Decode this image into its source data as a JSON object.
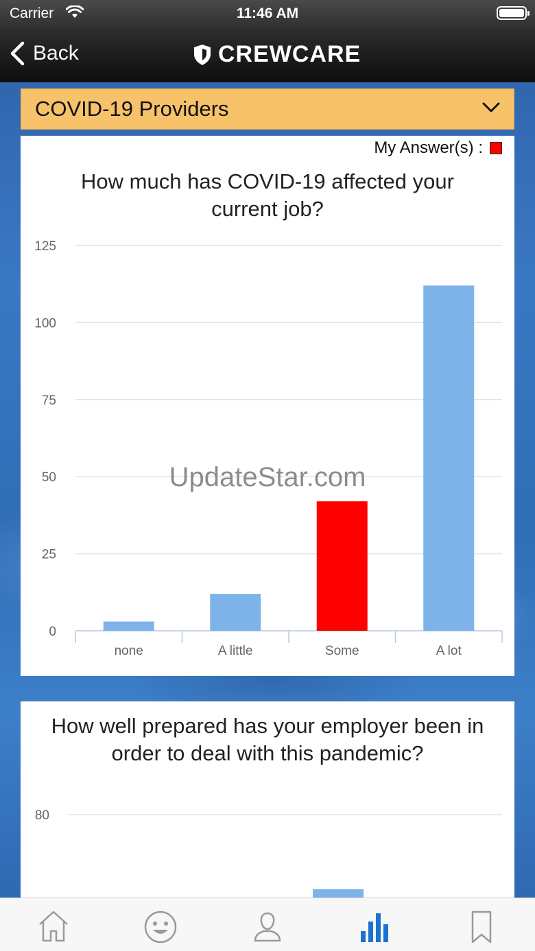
{
  "status_bar": {
    "carrier": "Carrier",
    "time": "11:46 AM"
  },
  "nav": {
    "back_label": "Back",
    "brand": "CREWCARE"
  },
  "dropdown": {
    "selected": "COVID-19 Providers"
  },
  "legend": {
    "my_answers_label": "My Answer(s) :",
    "my_answer_color": "#ff0000"
  },
  "watermark": "UpdateStar.com",
  "colors": {
    "bar": "#7eb3ea",
    "highlight": "#ff0000",
    "dropdown_bg": "#f8c26b"
  },
  "chart_data": [
    {
      "type": "bar",
      "title": "How much has COVID-19 affected your current job?",
      "categories": [
        "none",
        "A little",
        "Some",
        "A lot"
      ],
      "values": [
        3,
        12,
        42,
        112
      ],
      "highlighted_category": "Some",
      "yticks": [
        0,
        25,
        50,
        75,
        100,
        125
      ],
      "ylim": [
        0,
        125
      ],
      "grid": true
    },
    {
      "type": "bar",
      "title": "How well prepared has your employer been in order to deal with this pandemic?",
      "yticks": [
        80
      ],
      "grid": true,
      "partially_visible": true
    }
  ],
  "tabs": [
    {
      "name": "home-icon"
    },
    {
      "name": "smiley-icon"
    },
    {
      "name": "profile-icon"
    },
    {
      "name": "bar-chart-icon",
      "active": true
    },
    {
      "name": "bookmark-icon"
    }
  ]
}
